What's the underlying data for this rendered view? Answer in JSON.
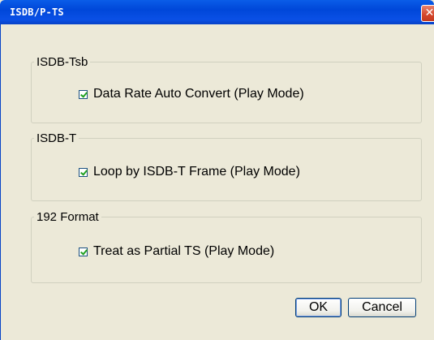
{
  "window": {
    "title": "ISDB/P-TS",
    "close_glyph": "✕"
  },
  "groups": [
    {
      "legend": "ISDB-Tsb",
      "checkbox_label": "Data Rate Auto Convert (Play Mode)",
      "checked": true
    },
    {
      "legend": "ISDB-T",
      "checkbox_label": "Loop by ISDB-T Frame (Play Mode)",
      "checked": true
    },
    {
      "legend": "192 Format",
      "checkbox_label": "Treat as Partial TS (Play Mode)",
      "checked": true
    }
  ],
  "buttons": {
    "ok_label": "OK",
    "cancel_label": "Cancel"
  },
  "colors": {
    "titlebar": "#0047d9",
    "dialog_bg": "#ece9d8",
    "close_button": "#d4462b",
    "checkmark": "#21a121"
  }
}
